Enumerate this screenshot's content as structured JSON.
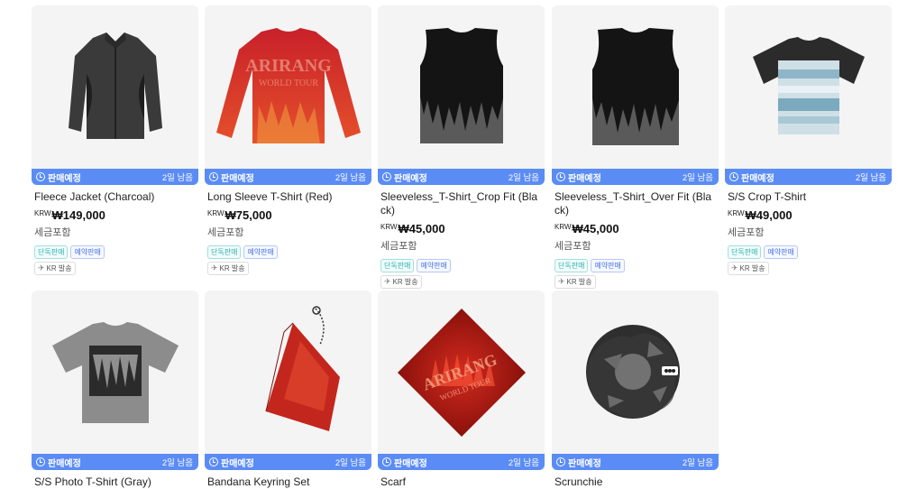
{
  "products": [
    {
      "name": "Fleece Jacket (Charcoal)",
      "currency": "KRW",
      "price": "₩149,000",
      "tax": "세금포함",
      "status": "판매예정",
      "remaining": "2일 남음",
      "badges": [
        "단독판매",
        "예약판매"
      ],
      "shipping": "KR 발송"
    },
    {
      "name": "Long Sleeve T-Shirt (Red)",
      "currency": "KRW",
      "price": "₩75,000",
      "tax": "세금포함",
      "status": "판매예정",
      "remaining": "2일 남음",
      "badges": [
        "단독판매",
        "예약판매"
      ],
      "shipping": "KR 발송"
    },
    {
      "name": "Sleeveless_T-Shirt_Crop Fit (Black)",
      "currency": "KRW",
      "price": "₩45,000",
      "tax": "세금포함",
      "status": "판매예정",
      "remaining": "2일 남음",
      "badges": [
        "단독판매",
        "예약판매"
      ],
      "shipping": "KR 발송"
    },
    {
      "name": "Sleeveless_T-Shirt_Over Fit (Black)",
      "currency": "KRW",
      "price": "₩45,000",
      "tax": "세금포함",
      "status": "판매예정",
      "remaining": "2일 남음",
      "badges": [
        "단독판매",
        "예약판매"
      ],
      "shipping": "KR 발송"
    },
    {
      "name": "S/S Crop T-Shirt",
      "currency": "KRW",
      "price": "₩49,000",
      "tax": "세금포함",
      "status": "판매예정",
      "remaining": "2일 남음",
      "badges": [
        "단독판매",
        "예약판매"
      ],
      "shipping": "KR 발송"
    },
    {
      "name": "S/S Photo T-Shirt (Gray)",
      "status": "판매예정",
      "remaining": "2일 남음"
    },
    {
      "name": "Bandana Keyring Set",
      "status": "판매예정",
      "remaining": "2일 남음"
    },
    {
      "name": "Scarf",
      "status": "판매예정",
      "remaining": "2일 남음"
    },
    {
      "name": "Scrunchie",
      "status": "판매예정",
      "remaining": "2일 남음"
    }
  ],
  "images": {
    "jacket_text": "",
    "long_sleeve_print": "ARIRANG",
    "long_sleeve_sub": "WORLD TOUR",
    "scarf_print": "ARIRANG",
    "scarf_sub": "WORLD TOUR"
  },
  "colors": {
    "sale_bar": "#5b8cf5",
    "badge_exclusive": "#2bb5b0",
    "badge_preorder": "#4a72e8"
  },
  "icons": [
    "clock-icon",
    "airplane-icon"
  ]
}
